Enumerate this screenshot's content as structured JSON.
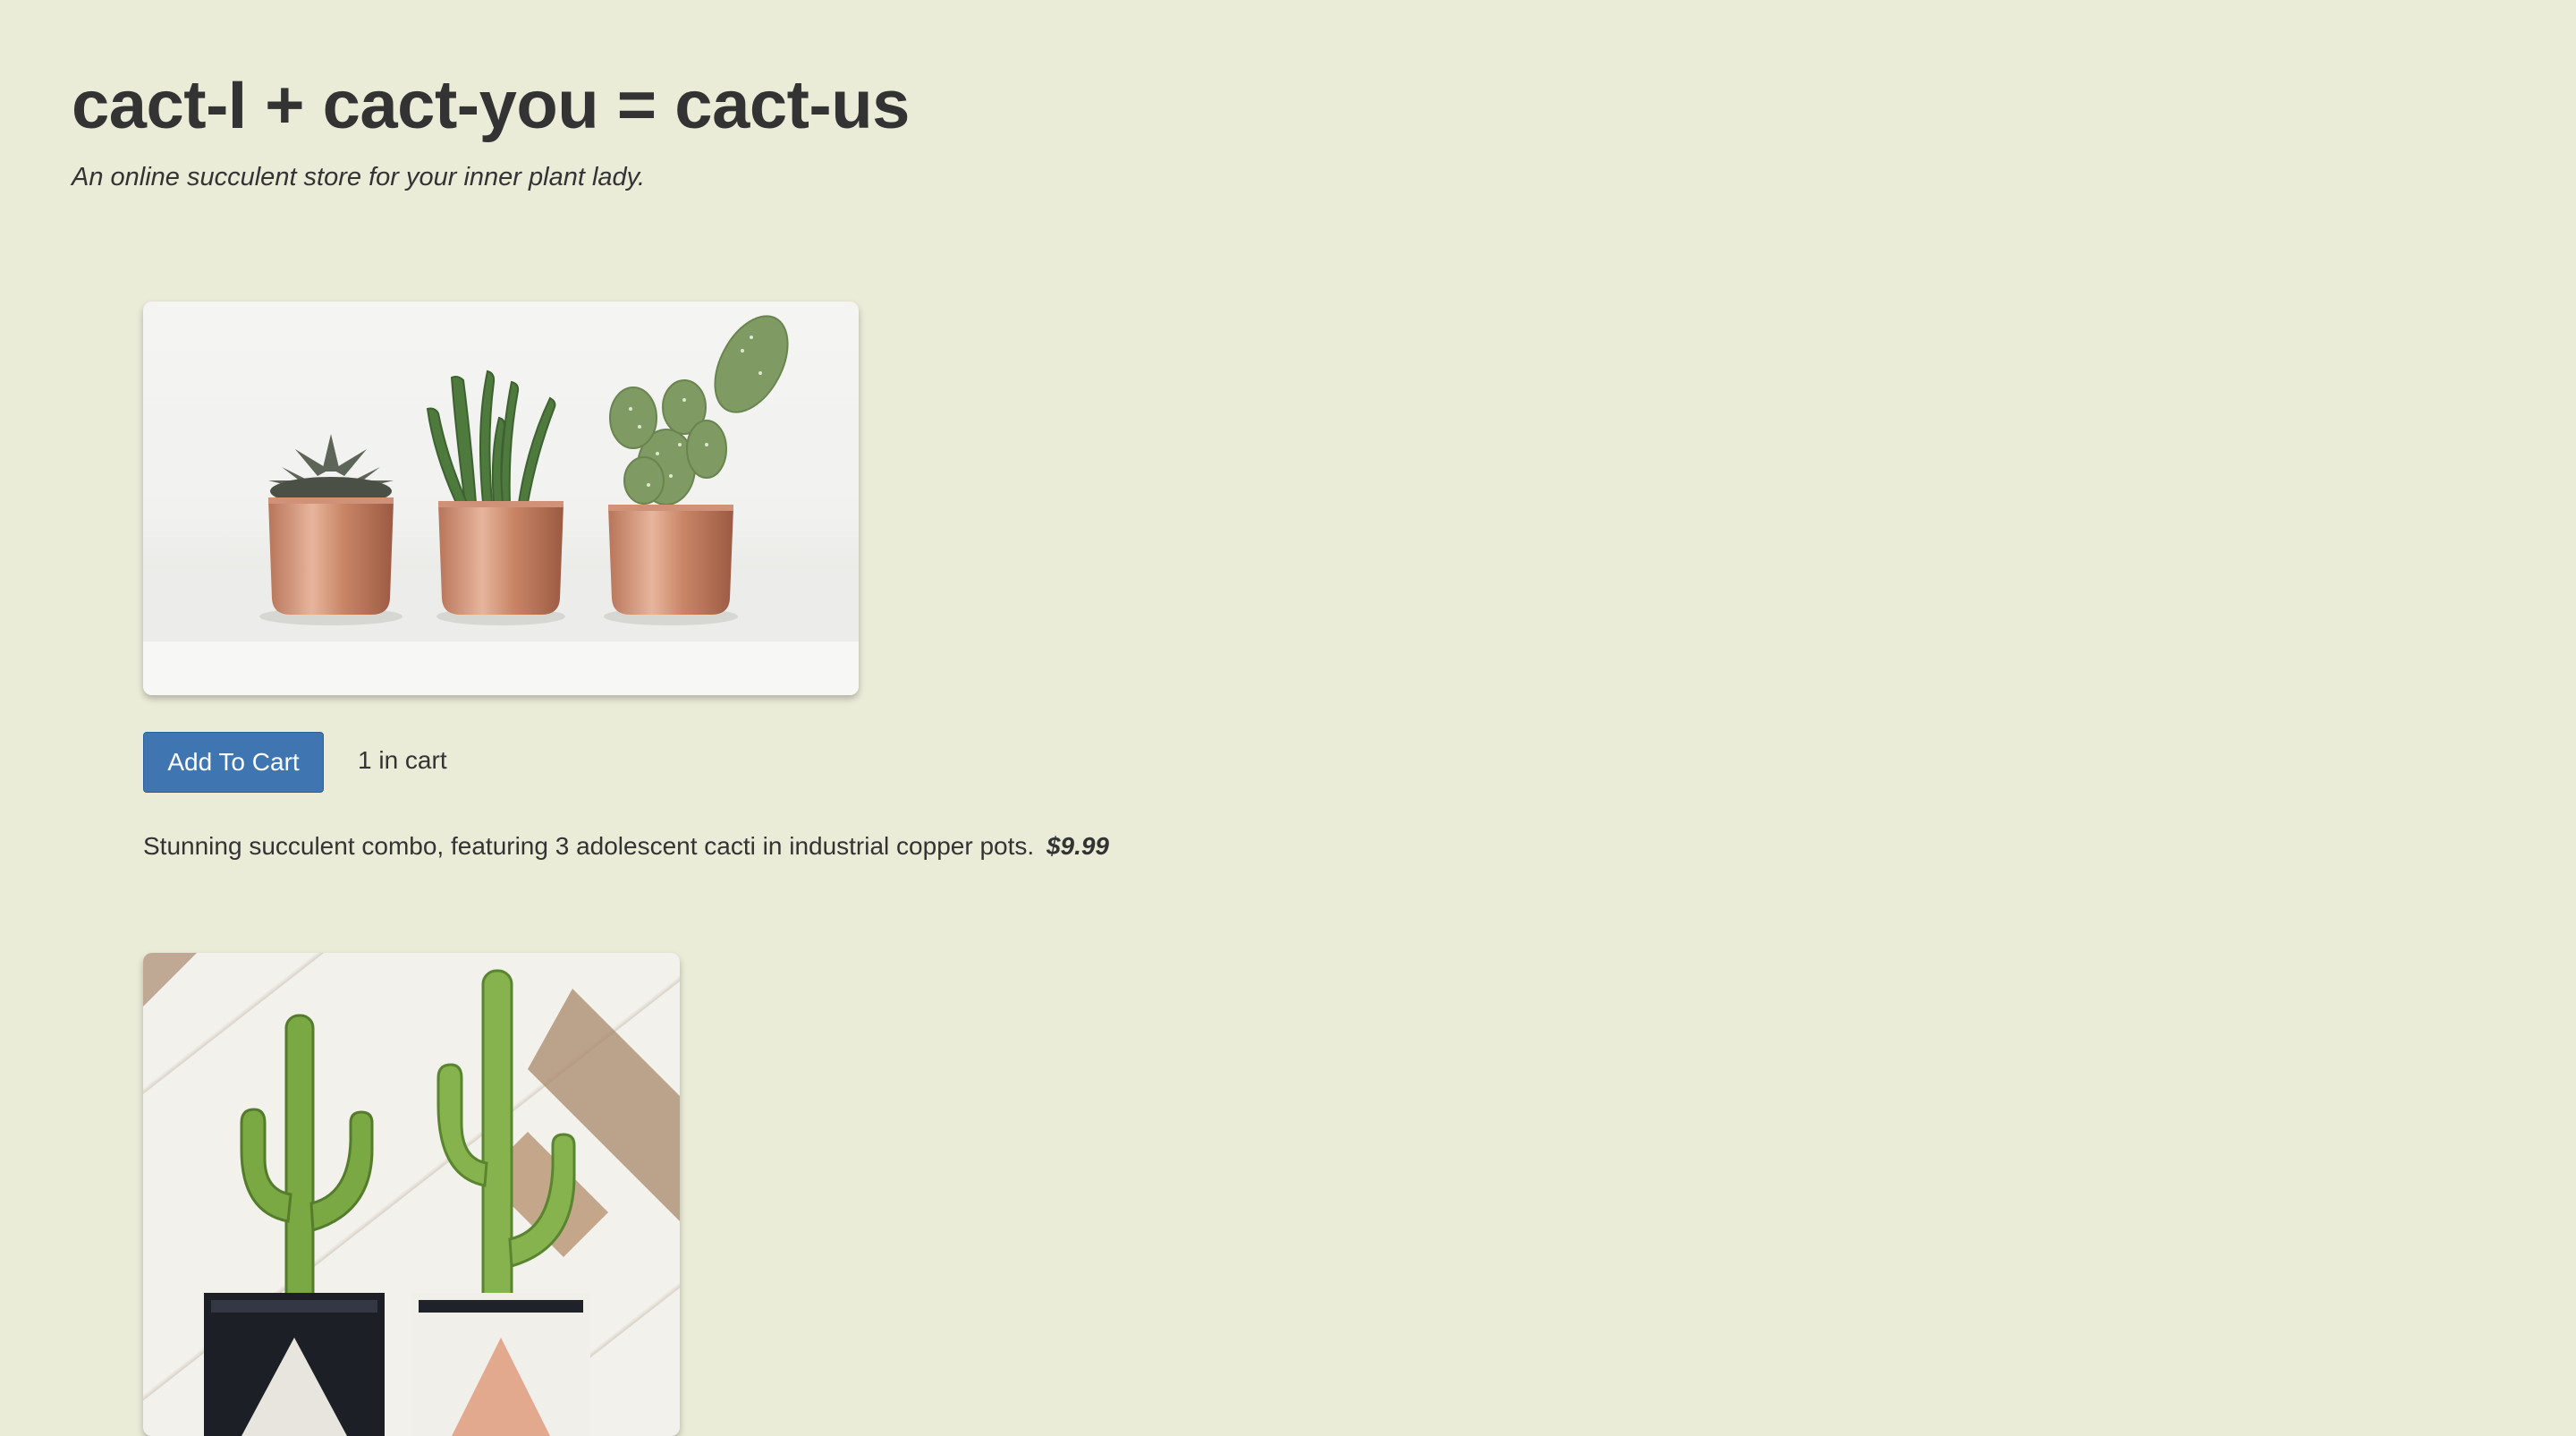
{
  "header": {
    "title": "cact-I + cact-you = cact-us",
    "tagline": "An online succulent store for your inner plant lady."
  },
  "products": [
    {
      "image_alt": "three succulents in copper pots",
      "button_label": "Add To Cart",
      "cart_status": "1 in cart",
      "description": "Stunning succulent combo, featuring 3 adolescent cacti in industrial copper pots.",
      "price": "$9.99"
    },
    {
      "image_alt": "two cacti in geometric pots"
    }
  ],
  "colors": {
    "background": "#ebecd8",
    "text": "#333333",
    "button": "#3f76b1",
    "button_text": "#ffffff"
  }
}
